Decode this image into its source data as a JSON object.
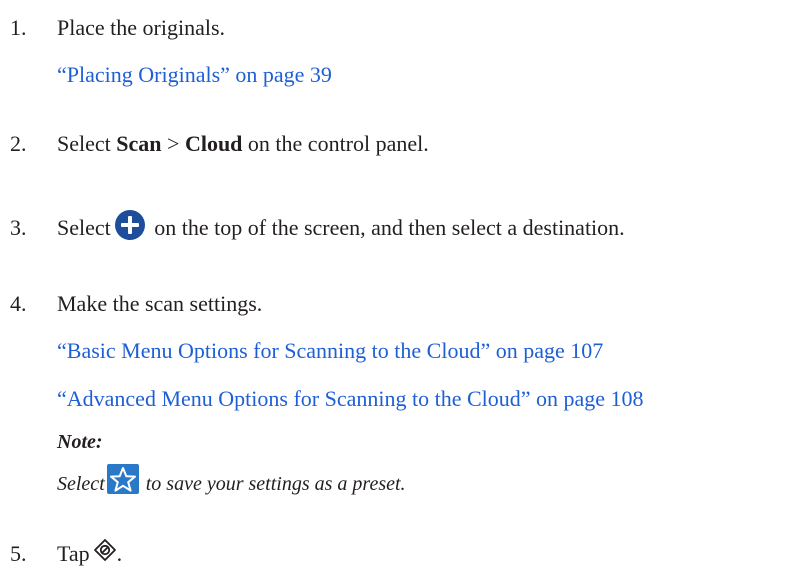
{
  "steps": [
    {
      "number": "1.",
      "text": "Place the originals.",
      "link": "“Placing Originals” on page 39"
    },
    {
      "number": "2.",
      "pre": "Select ",
      "bold1": "Scan",
      "sep": " > ",
      "bold2": "Cloud",
      "post": " on the control panel."
    },
    {
      "number": "3.",
      "pre": "Select",
      "icon": "add-circle-icon",
      "post": " on the top of the screen, and then select a destination."
    },
    {
      "number": "4.",
      "text": "Make the scan settings.",
      "link1": "“Basic Menu Options for Scanning to the Cloud” on page 107",
      "link2": "“Advanced Menu Options for Scanning to the Cloud” on page 108",
      "note_title": "Note:",
      "note_pre": "Select",
      "note_icon": "preset-star-icon",
      "note_post": " to save your settings as a preset."
    },
    {
      "number": "5.",
      "pre": "Tap",
      "icon": "start-button-icon",
      "post": "."
    }
  ],
  "colors": {
    "text": "#231f20",
    "link": "#1f5fd6",
    "plus_icon": "#1e4e9b",
    "star_icon": "#2a79c9"
  }
}
